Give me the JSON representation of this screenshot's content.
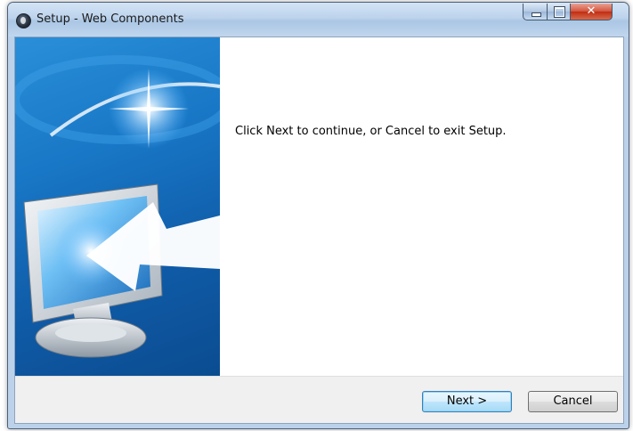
{
  "window": {
    "title": "Setup - Web Components",
    "controls": {
      "minimize": "minimize",
      "maximize": "maximize",
      "close": "✕"
    }
  },
  "main": {
    "message": "Click Next to continue, or Cancel to exit Setup."
  },
  "footer": {
    "next_label": "Next >",
    "cancel_label": "Cancel"
  },
  "icons": {
    "app": "setup-app-icon",
    "banner": "monitor-with-arrow-illustration"
  },
  "colors": {
    "banner_blue": "#1877c6",
    "titlebar": "#bcd3ec",
    "close_red": "#c12d12",
    "next_focus_border": "#3c7fb1"
  }
}
